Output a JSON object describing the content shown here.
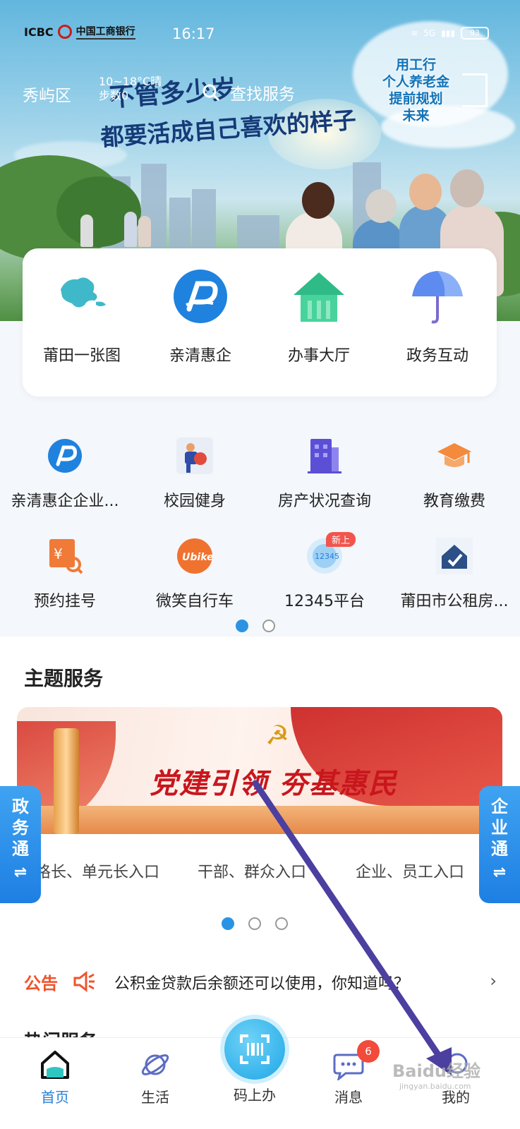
{
  "status_bar": {
    "bank_brand": "ICBC",
    "bank_name_cn": "中国工商银行",
    "time": "16:17",
    "network": "5G",
    "battery": "93"
  },
  "header": {
    "district": "秀屿区",
    "weather_temp": "10~18°C",
    "weather_cond": "晴",
    "weather_sub": "步数0",
    "search_label": "查找服务"
  },
  "banner": {
    "slogan_line1": "不管多少岁",
    "slogan_line2": "都要活成自己喜欢的样子",
    "promo_lines": [
      "用工行",
      "个人养老金",
      "提前规划",
      "未来"
    ]
  },
  "quick_actions": [
    {
      "label": "莆田一张图",
      "icon": "map-icon"
    },
    {
      "label": "亲清惠企",
      "icon": "qinqing-logo-icon"
    },
    {
      "label": "办事大厅",
      "icon": "house-icon"
    },
    {
      "label": "政务互动",
      "icon": "umbrella-icon"
    }
  ],
  "services": [
    {
      "label": "亲清惠企企业...",
      "icon": "qinqing-logo-icon"
    },
    {
      "label": "校园健身",
      "icon": "campus-fitness-icon"
    },
    {
      "label": "房产状况查询",
      "icon": "building-icon"
    },
    {
      "label": "教育缴费",
      "icon": "graduation-cap-icon"
    },
    {
      "label": "预约挂号",
      "icon": "registration-icon"
    },
    {
      "label": "微笑自行车",
      "icon": "ubike-icon"
    },
    {
      "label": "12345平台",
      "icon": "hotline-12345-icon",
      "badge": "新上"
    },
    {
      "label": "莆田市公租房...",
      "icon": "public-housing-icon"
    }
  ],
  "theme_section": {
    "title": "主题服务",
    "banner_title": "党建引领 夯基惠民",
    "entries": [
      "格长、单元长入口",
      "干部、群众入口",
      "企业、员工入口"
    ]
  },
  "side_tabs": {
    "left": "政务通",
    "right": "企业通",
    "swap_symbol": "⇌"
  },
  "notice": {
    "tag": "公告",
    "text": "公积金贷款后余额还可以使用，你知道吗？"
  },
  "next_section_peek": "热门服务",
  "bottom_nav": {
    "items": [
      {
        "label": "首页",
        "icon": "home-icon",
        "active": true
      },
      {
        "label": "生活",
        "icon": "planet-icon"
      },
      {
        "label": "码上办",
        "icon": "scan-code-icon"
      },
      {
        "label": "消息",
        "icon": "chat-bubble-icon",
        "badge": "6"
      },
      {
        "label": "我的",
        "icon": "profile-icon"
      }
    ]
  },
  "watermark": {
    "brand": "Baidu经验",
    "sub": "jingyan.baidu.com"
  },
  "colors": {
    "accent_blue": "#2a93e4",
    "notice_orange": "#f0532b",
    "badge_red": "#f24a3b",
    "overlay_arrow": "#4b3fa0"
  }
}
